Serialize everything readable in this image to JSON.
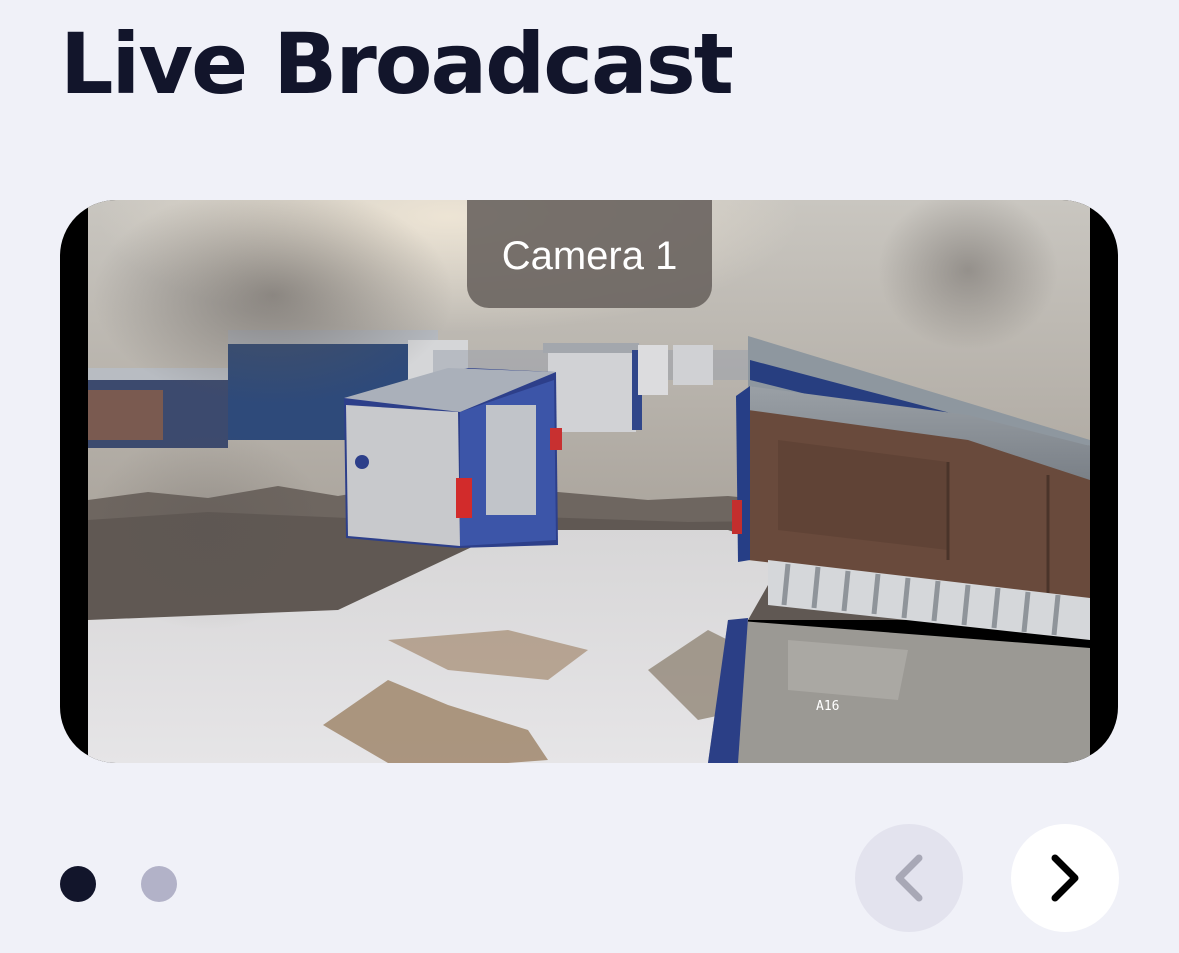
{
  "header": {
    "title": "Live Broadcast"
  },
  "broadcast": {
    "camera_label": "Camera 1",
    "camera_id_overlay": "A16"
  },
  "pagination": {
    "page_count": 2,
    "active_index": 0
  },
  "navigation": {
    "prev_icon": "chevron-left-icon",
    "next_icon": "chevron-right-icon",
    "prev_enabled": false,
    "next_enabled": true
  },
  "colors": {
    "background": "#f0f1f8",
    "title": "#12152b",
    "dot_active": "#12152b",
    "dot_inactive": "#b2b2c8",
    "prev_button_bg": "#e3e3ee",
    "prev_chevron": "#a8a8b6",
    "next_button_bg": "#ffffff",
    "next_chevron": "#000000",
    "camera_badge_bg": "#6c6662"
  }
}
